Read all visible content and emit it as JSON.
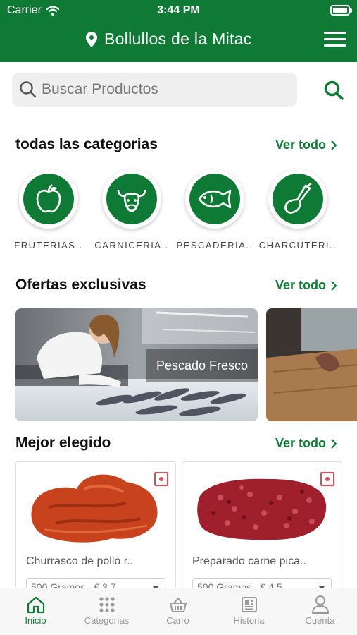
{
  "status": {
    "carrier": "Carrier",
    "time": "3:44 PM"
  },
  "header": {
    "location": "Bollullos de la Mitac",
    "menu_icon": "hamburger-menu-icon"
  },
  "search": {
    "placeholder": "Buscar Productos"
  },
  "categories": {
    "title": "todas las categorias",
    "see_all": "Ver todo",
    "items": [
      {
        "label": "FRUTERIAS..",
        "icon": "apple-icon"
      },
      {
        "label": "CARNICERIA..",
        "icon": "bull-icon"
      },
      {
        "label": "PESCADERIA..",
        "icon": "fish-icon"
      },
      {
        "label": "CHARCUTERI..",
        "icon": "ham-icon"
      }
    ]
  },
  "offers": {
    "title": "Ofertas exclusivas",
    "see_all": "Ver todo",
    "items": [
      {
        "label": "Pescado Fresco"
      }
    ]
  },
  "best": {
    "title": "Mejor elegido",
    "see_all": "Ver todo",
    "items": [
      {
        "name": "Churrasco de pollo r..",
        "option": "500 Gramos - € 3.7"
      },
      {
        "name": "Preparado carne pica..",
        "option": "500 Gramos - € 4.5"
      }
    ]
  },
  "tabs": [
    {
      "label": "Inicio",
      "active": true
    },
    {
      "label": "Categorías"
    },
    {
      "label": "Carro"
    },
    {
      "label": "Historia"
    },
    {
      "label": "Cuenta"
    }
  ],
  "colors": {
    "brand_green": "#0f7a35",
    "badge_red": "#e04a5a"
  }
}
